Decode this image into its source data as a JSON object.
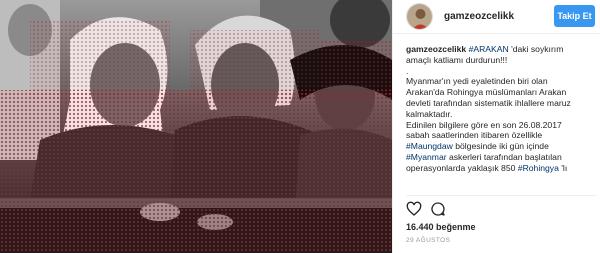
{
  "post": {
    "username": "gamzeozcelikk",
    "follow_label": "Takip Et",
    "likes": "16.440 beğenme",
    "date": "29 AĞUSTOS"
  },
  "caption": {
    "username": "gamzeozcelikk",
    "lines": [
      [
        {
          "t": "#ARAKAN",
          "tag": true
        },
        {
          "t": " 'daki soykırım",
          "tag": false
        }
      ],
      [
        {
          "t": "amaçlı katliamı durdurun!!!",
          "tag": false
        }
      ],
      [
        {
          "t": ".",
          "tag": false
        }
      ],
      [
        {
          "t": "Myanmar'ın yedi eyaletinden biri olan",
          "tag": false
        }
      ],
      [
        {
          "t": "Arakan'da Rohingya müslümanları Arakan",
          "tag": false
        }
      ],
      [
        {
          "t": "devleti tarafından sistematik ihlallere maruz",
          "tag": false
        }
      ],
      [
        {
          "t": "kalmaktadır.",
          "tag": false
        }
      ],
      [
        {
          "t": "Edinilen bilgilere göre en son 26.08.2017",
          "tag": false
        }
      ],
      [
        {
          "t": "sabah saatlerinden itibaren özellikle",
          "tag": false
        }
      ],
      [
        {
          "t": "#Maungdaw",
          "tag": true
        },
        {
          "t": " bölgesinde iki gün içinde",
          "tag": false
        }
      ],
      [
        {
          "t": "#Myanmar",
          "tag": true
        },
        {
          "t": " askerleri tarafından başlatılan",
          "tag": false
        }
      ],
      [
        {
          "t": "operasyonlarda yaklaşık 850 ",
          "tag": false
        },
        {
          "t": "#Rohingya",
          "tag": true
        },
        {
          "t": " 'lı",
          "tag": false
        }
      ]
    ]
  },
  "icons": {
    "like": "heart-icon",
    "comment": "comment-icon"
  },
  "colors": {
    "accent": "#3897f0",
    "hashtag": "#003569",
    "overlay_red": "#d0202a"
  }
}
